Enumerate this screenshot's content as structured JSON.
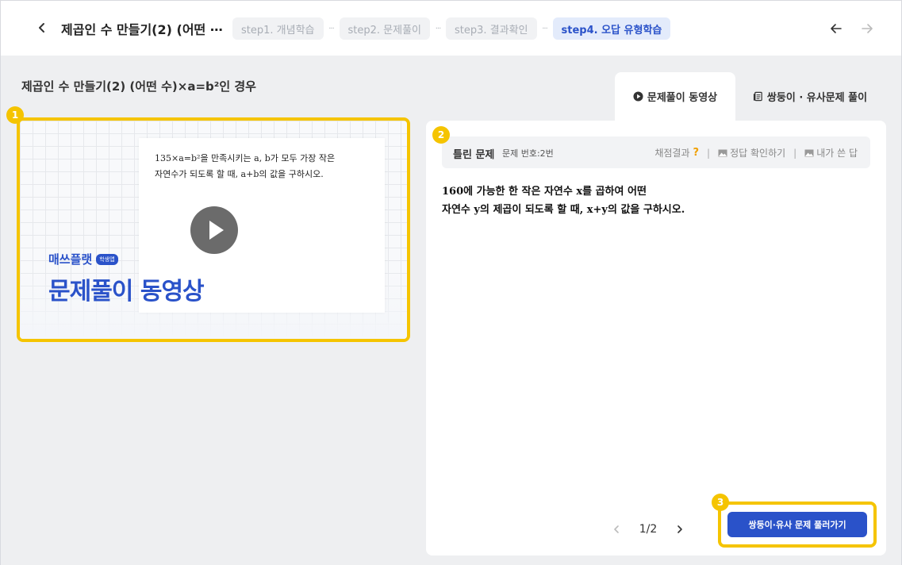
{
  "header": {
    "lesson_title": "제곱인 수 만들기(2) (어떤 ⋯",
    "steps": [
      {
        "label": "step1. 개념학습",
        "active": false
      },
      {
        "label": "step2. 문제풀이",
        "active": false
      },
      {
        "label": "step3. 결과확인",
        "active": false
      },
      {
        "label": "step4. 오답 유형학습",
        "active": true
      }
    ],
    "step_separator": "···",
    "icons": {
      "back": "chevron-left-icon",
      "prev": "arrow-left-icon",
      "next": "arrow-right-icon"
    }
  },
  "page_title": "제곱인 수 만들기(2) (어떤 수)×a=b²인 경우",
  "badges": [
    "1",
    "2",
    "3"
  ],
  "video": {
    "problem_line1": "135×a=b²을 만족시키는 a, b가 모두 가장 작은",
    "problem_line2": "자연수가 되도록 할 때, a+b의 값을 구하시오.",
    "brand": "매쓰플랫",
    "brand_badge": "학생앱",
    "heading": "문제풀이 동영상",
    "play_icon": "play-icon"
  },
  "tabs": [
    {
      "label": "문제풀이 동영상",
      "icon": "play-circle-icon",
      "active": true
    },
    {
      "label": "쌍둥이 · 유사문제 풀이",
      "icon": "document-list-icon",
      "active": false
    }
  ],
  "panel": {
    "wrong_label": "틀린 문제",
    "problem_number": "문제 번호:2번",
    "grading_result": "채점결과",
    "grading_mark": "?",
    "answer_link": "정답 확인하기",
    "my_answer_link": "내가 쓴 답",
    "question_line1": "160에 가능한 한 작은 자연수 x를 곱하여 어떤",
    "question_line2": "자연수 y의 제곱이 되도록 할 때, x+y의 값을 구하시오.",
    "page_indicator": "1/2",
    "cta_label": "쌍둥이·유사 문제 풀러가기"
  },
  "colors": {
    "accent": "#2a52c9",
    "highlight": "#f5c400",
    "background": "#eeeff1"
  }
}
